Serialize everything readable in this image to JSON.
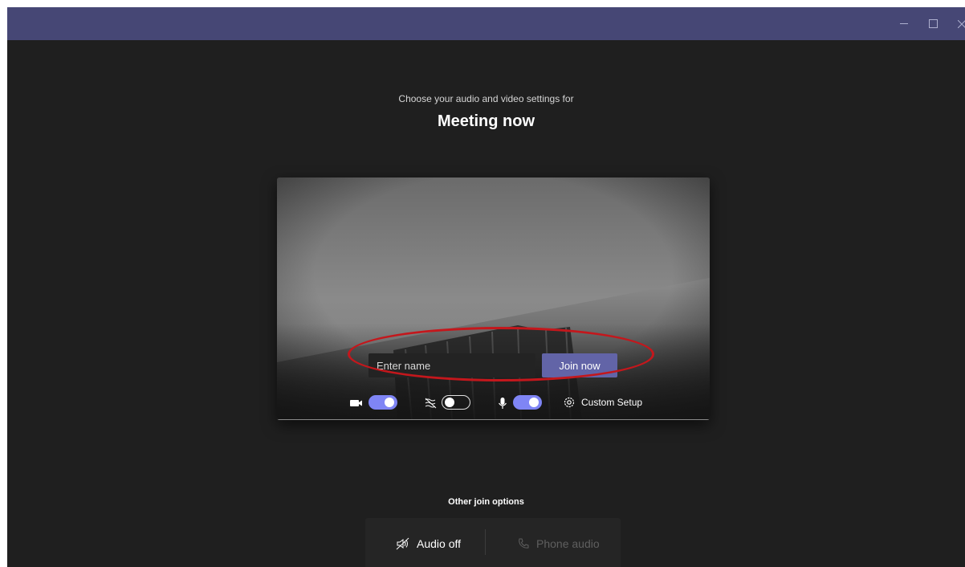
{
  "window": {
    "minimize_label": "Minimize",
    "maximize_label": "Maximize",
    "close_label": "Close"
  },
  "header": {
    "prompt": "Choose your audio and video settings for",
    "meeting_title": "Meeting now"
  },
  "preview": {
    "name_placeholder": "Enter name",
    "name_value": "",
    "join_label": "Join now",
    "camera_toggle": true,
    "blur_toggle": false,
    "mic_toggle": true,
    "custom_setup_label": "Custom Setup"
  },
  "other_options": {
    "label": "Other join options",
    "audio_off_label": "Audio off",
    "phone_audio_label": "Phone audio"
  },
  "colors": {
    "titlebar": "#464775",
    "background": "#1f1f1f",
    "accent": "#6264a7",
    "toggle_on": "#7f85f5",
    "annotation": "#c4171c"
  }
}
